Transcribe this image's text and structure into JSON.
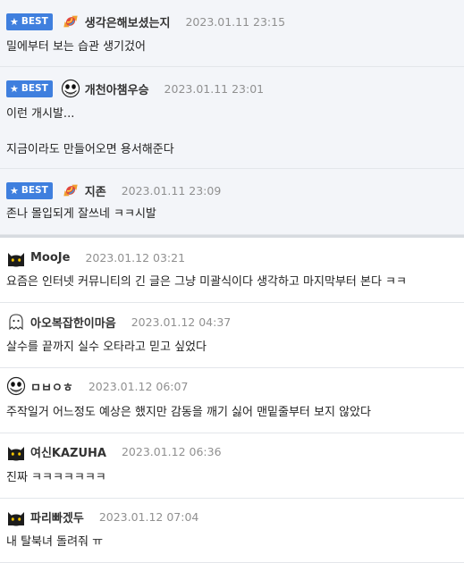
{
  "best_label": "BEST",
  "colors": {
    "accent": "#3f7fde",
    "best_bg": "#f3f5f9",
    "date": "#909090"
  },
  "comments": [
    {
      "best": true,
      "avatar": "candy-icon",
      "nick": "생각은해보셨는지",
      "date": "2023.01.11 23:15",
      "lines": [
        "밀에부터 보는 습관 생기겄어"
      ]
    },
    {
      "best": true,
      "avatar": "jack-skellington-icon",
      "nick": "개천아챔우승",
      "date": "2023.01.11 23:01",
      "lines": [
        "이런 개시발...",
        "지금이라도 만들어오면 용서해준다"
      ]
    },
    {
      "best": true,
      "avatar": "candy-icon",
      "nick": "지존",
      "date": "2023.01.11 23:09",
      "lines": [
        "존나 몰입되게 잘쓰네 ㅋㅋ시발"
      ]
    },
    {
      "best": false,
      "avatar": "black-cat-icon",
      "nick": "MooJe",
      "date": "2023.01.12 03:21",
      "lines": [
        "요즘은 인터넷 커뮤니티의 긴 글은 그냥 미괄식이다 생각하고 마지막부터 본다 ㅋㅋ"
      ]
    },
    {
      "best": false,
      "avatar": "ghost-icon",
      "nick": "아오복잡한이마음",
      "date": "2023.01.12 04:37",
      "lines": [
        "살수를 끝까지 실수 오타라고 믿고 싶었다"
      ]
    },
    {
      "best": false,
      "avatar": "jack-skellington-icon",
      "nick": "ㅁㅂㅇㅎ",
      "date": "2023.01.12 06:07",
      "lines": [
        "주작일거 어느정도 예상은 했지만 감동을 깨기 싫어 맨밑줄부터 보지 않았다"
      ]
    },
    {
      "best": false,
      "avatar": "black-cat-icon",
      "nick": "여신KAZUHA",
      "date": "2023.01.12 06:36",
      "lines": [
        "진짜 ㅋㅋㅋㅋㅋㅋㅋ"
      ]
    },
    {
      "best": false,
      "avatar": "black-cat-icon",
      "nick": "파리빠겠두",
      "date": "2023.01.12 07:04",
      "lines": [
        "내 탈북녀 돌려줘 ㅠ"
      ]
    }
  ]
}
